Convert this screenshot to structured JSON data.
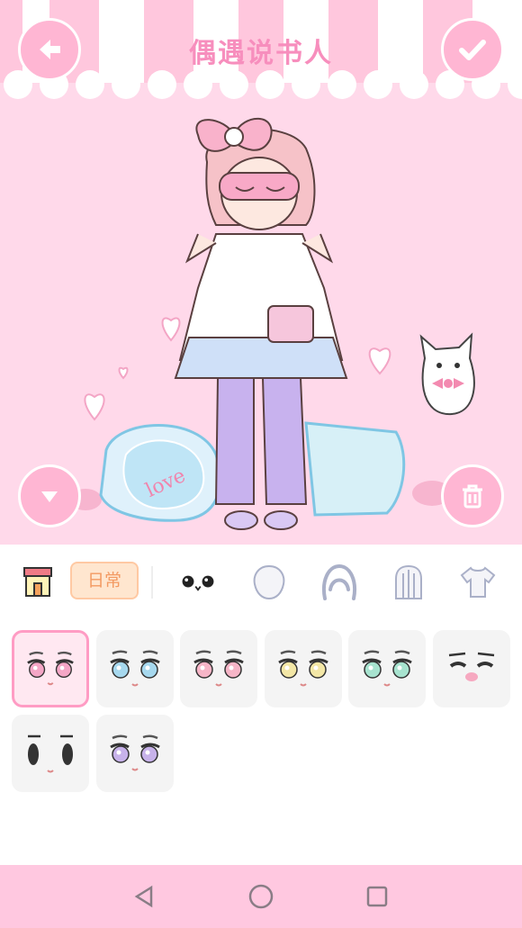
{
  "header": {
    "title": "偶遇说书人",
    "back_icon": "arrow-left-icon",
    "confirm_icon": "check-icon"
  },
  "stage": {
    "left_button_icon": "chevron-down-icon",
    "right_button_icon": "trash-icon"
  },
  "category_bar": {
    "shop_icon": "shop-icon",
    "tag_label": "日常",
    "tabs": [
      "face-eyes-icon",
      "head-icon",
      "hair-icon",
      "back-hair-icon",
      "shirt-icon"
    ]
  },
  "eyes": {
    "items": [
      {
        "name": "pink-eyes",
        "iris": "#f4a6c6",
        "selected": true
      },
      {
        "name": "blue-eyes",
        "iris": "#a6d8ee",
        "selected": false
      },
      {
        "name": "pink-round-eyes",
        "iris": "#f6b5c7",
        "selected": false
      },
      {
        "name": "yellow-eyes",
        "iris": "#f3e7a6",
        "selected": false
      },
      {
        "name": "mint-eyes",
        "iris": "#a7e3cf",
        "selected": false
      },
      {
        "name": "closed-smile-eyes",
        "iris": "#444444",
        "selected": false
      },
      {
        "name": "black-dot-eyes",
        "iris": "#333333",
        "selected": false
      },
      {
        "name": "purple-eyes",
        "iris": "#c7b2ea",
        "selected": false
      }
    ]
  },
  "colors": {
    "accent_pink": "#ffb6d3",
    "stage_bg": "#ffd9ea",
    "title_pink": "#f78ebd",
    "navbar": "#ffc8e0",
    "chip_bg": "#ffe6cf",
    "chip_text": "#f39a62"
  },
  "navbar": {
    "back": "triangle-back-icon",
    "home": "circle-home-icon",
    "recents": "square-recents-icon"
  }
}
